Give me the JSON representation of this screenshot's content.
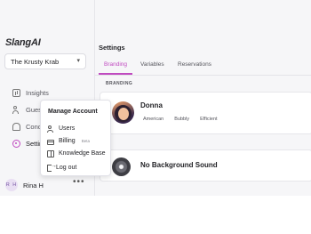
{
  "app": {
    "logo": "SlangAI"
  },
  "sidebar": {
    "venue": "The Krusty Krab",
    "items": [
      {
        "label": "Insights"
      },
      {
        "label": "Guest"
      },
      {
        "label": "Concie"
      },
      {
        "label": "Settin"
      }
    ],
    "user": {
      "initials": "R H",
      "name": "Rina H",
      "more": "•••"
    }
  },
  "main": {
    "title": "Settings",
    "tabs": [
      {
        "label": "Branding"
      },
      {
        "label": "Variables"
      },
      {
        "label": "Reservations"
      }
    ],
    "section_label": "BRANDING",
    "persona": {
      "name": "Donna",
      "traits": [
        "American",
        "Bubbly",
        "Efficient"
      ]
    },
    "background_sound": {
      "title": "No Background Sound"
    }
  },
  "menu": {
    "header": "Manage Account",
    "items": [
      {
        "label": "Users"
      },
      {
        "label": "Billing",
        "badge": "Beta"
      },
      {
        "label": "Knowledge Base"
      },
      {
        "label": "Log out"
      }
    ]
  },
  "colors": {
    "accent": "#c04ac0",
    "background": "#f6f6f8"
  }
}
